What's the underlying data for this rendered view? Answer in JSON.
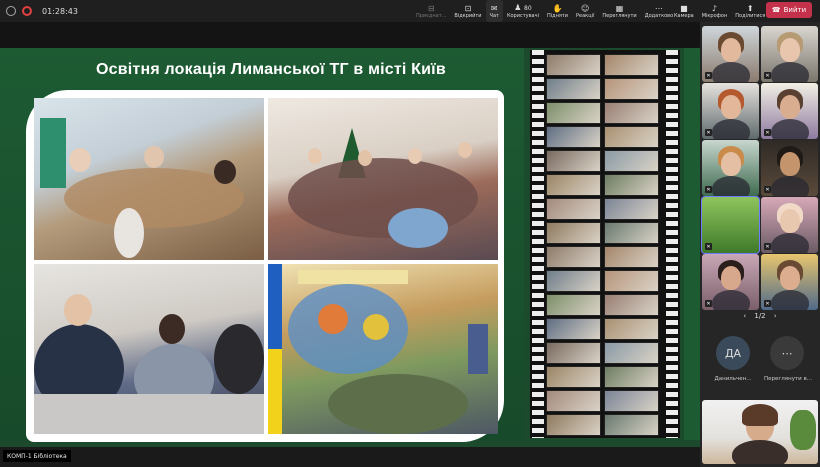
{
  "toolbar": {
    "timer": "01:28:43",
    "buttons": [
      {
        "label": "Приєднат...",
        "icon": "leave-room-icon",
        "dim": true
      },
      {
        "label": "Відкрийти",
        "icon": "open-icon",
        "dim": false
      },
      {
        "label": "Чат",
        "icon": "chat-icon",
        "dim": false,
        "active": true
      },
      {
        "label": "Користувачі",
        "icon": "people-icon",
        "count": "80"
      },
      {
        "label": "Підняти",
        "icon": "raise-hand-icon"
      },
      {
        "label": "Реакції",
        "icon": "smile-icon"
      },
      {
        "label": "Переглянути",
        "icon": "view-icon"
      },
      {
        "label": "Додатково",
        "icon": "more-icon"
      }
    ],
    "media": [
      {
        "label": "Камера",
        "icon": "camera-icon"
      },
      {
        "label": "Мікрофон",
        "icon": "mic-off-icon"
      },
      {
        "label": "Поділитися",
        "icon": "share-icon"
      }
    ],
    "leave_label": "Вийти"
  },
  "slide": {
    "title": "Освітня локація Лиманської ТГ в місті Київ"
  },
  "presenter_name": "КОМП-1 Бібліотека",
  "panel": {
    "pager": "1/2",
    "avatar_initials": "ДА",
    "avatar_label": "Данильчен...",
    "view_all_label": "Переглянути в..."
  }
}
